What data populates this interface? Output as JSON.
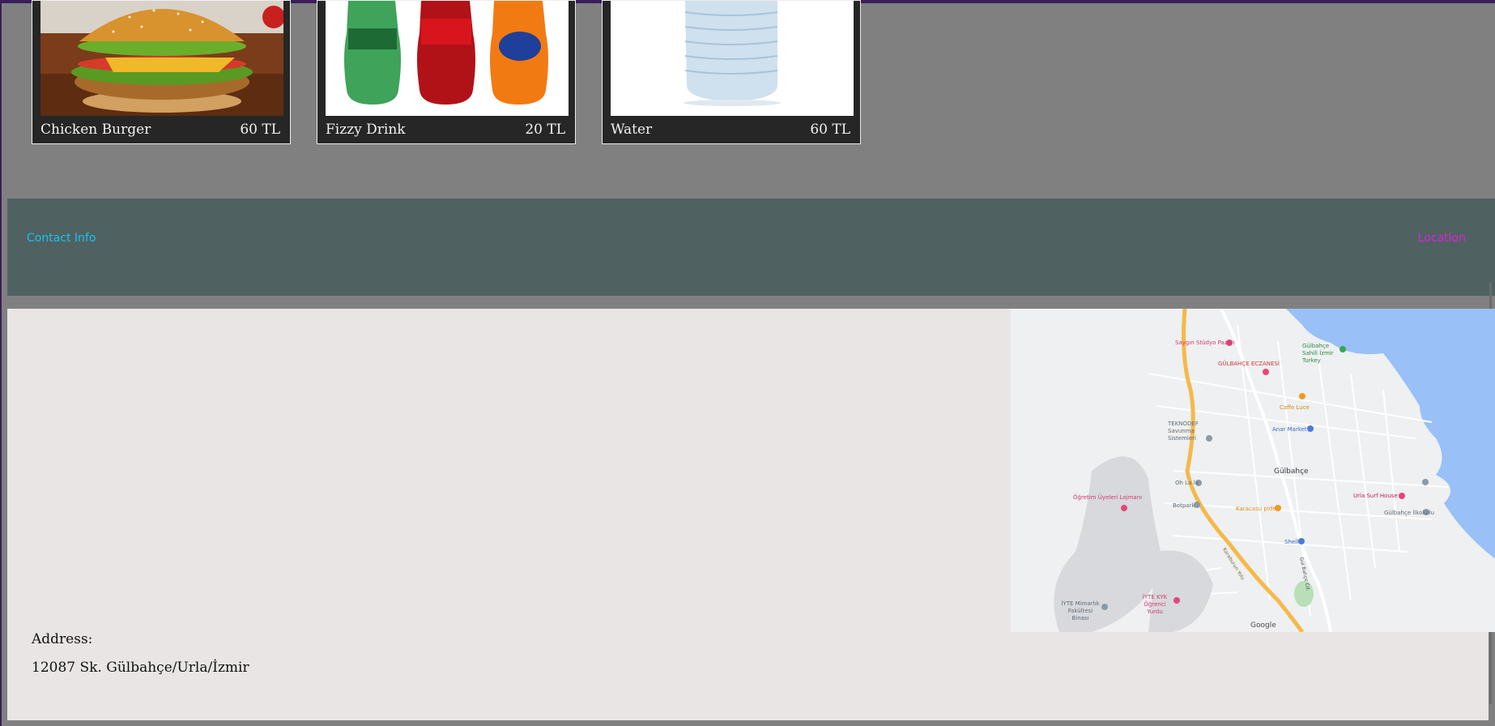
{
  "products": [
    {
      "name": "Chicken Burger",
      "price": "60 TL",
      "image": "burger-image"
    },
    {
      "name": "Fizzy Drink",
      "price": "20 TL",
      "image": "soda-bottles-image"
    },
    {
      "name": "Water",
      "price": "60 TL",
      "image": "water-bottle-image"
    }
  ],
  "footer": {
    "contact_label": "Contact Info",
    "location_label": "Location"
  },
  "address": {
    "label": "Address:",
    "value": "12087 Sk. Gülbahçe/Urla/İzmir"
  },
  "map": {
    "places": [
      {
        "name": "Saygın Stüdyo Pazarı"
      },
      {
        "name": "GÜLBAHÇE ECZANESİ"
      },
      {
        "name": "Caffe Luce"
      },
      {
        "name": "Gülbahçe Sahili İzmir Turkey"
      },
      {
        "name": "TEKNODEF Savunma Sistemleri"
      },
      {
        "name": "Anar Market"
      },
      {
        "name": "Gülbahçe"
      },
      {
        "name": "Oh La la"
      },
      {
        "name": "Botpark"
      },
      {
        "name": "Karacasu pide"
      },
      {
        "name": "Urla Surf House"
      },
      {
        "name": "Gülbahçe İlkokulu"
      },
      {
        "name": "Öğretim Üyeleri Lojmanı"
      },
      {
        "name": "Shell"
      },
      {
        "name": "İYTE KYK Öğrenci Yurdu"
      },
      {
        "name": "İYTE Mimarlık Fakültesi Binası"
      },
      {
        "name": "Karaburun Yolu"
      },
      {
        "name": "Gül Bahçe Cd."
      }
    ],
    "logo": "Google",
    "colors": {
      "sea": "#99c0f7",
      "road": "#f5b94a",
      "land": "#eef0f1"
    }
  }
}
